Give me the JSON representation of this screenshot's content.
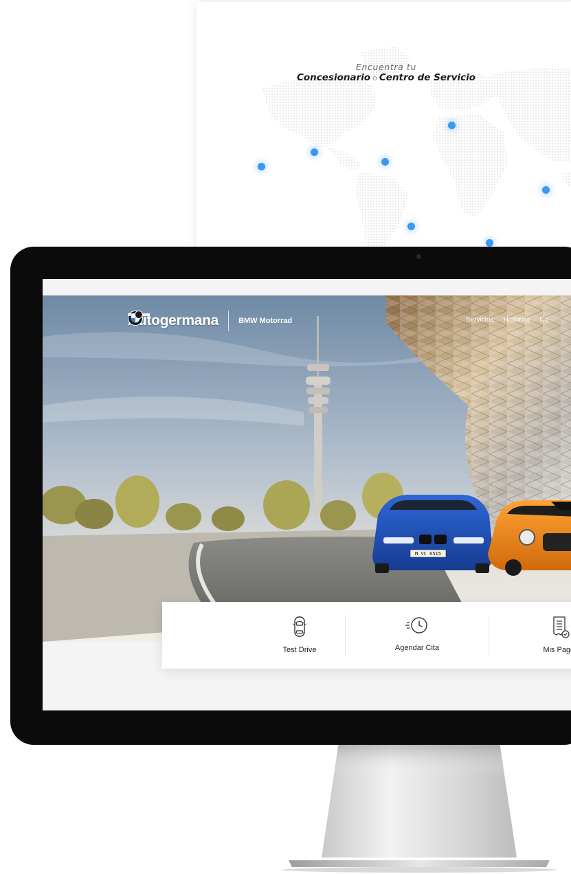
{
  "map_panel": {
    "subtitle": "Encuentra tu",
    "title_part1": "Concesionario",
    "title_sep": "o",
    "title_part2": "Centro de Servicio"
  },
  "header": {
    "brand": "Autogermana",
    "partner": "BMW Motorrad",
    "nav": [
      "Servicios",
      "Historias",
      "Co"
    ]
  },
  "hero": {
    "plate_bmw": "M VC 6515"
  },
  "actions": [
    {
      "label": "Test Drive",
      "icon": "car-top-icon"
    },
    {
      "label": "Agendar Cita",
      "icon": "clock-icon"
    },
    {
      "label": "Mis Pagos",
      "icon": "receipt-icon"
    }
  ],
  "colors": {
    "pin": "#3b97f0",
    "bezel": "#0b0b0b",
    "bmw_car": "#1f4fb8",
    "mini_car": "#f08a1c"
  }
}
